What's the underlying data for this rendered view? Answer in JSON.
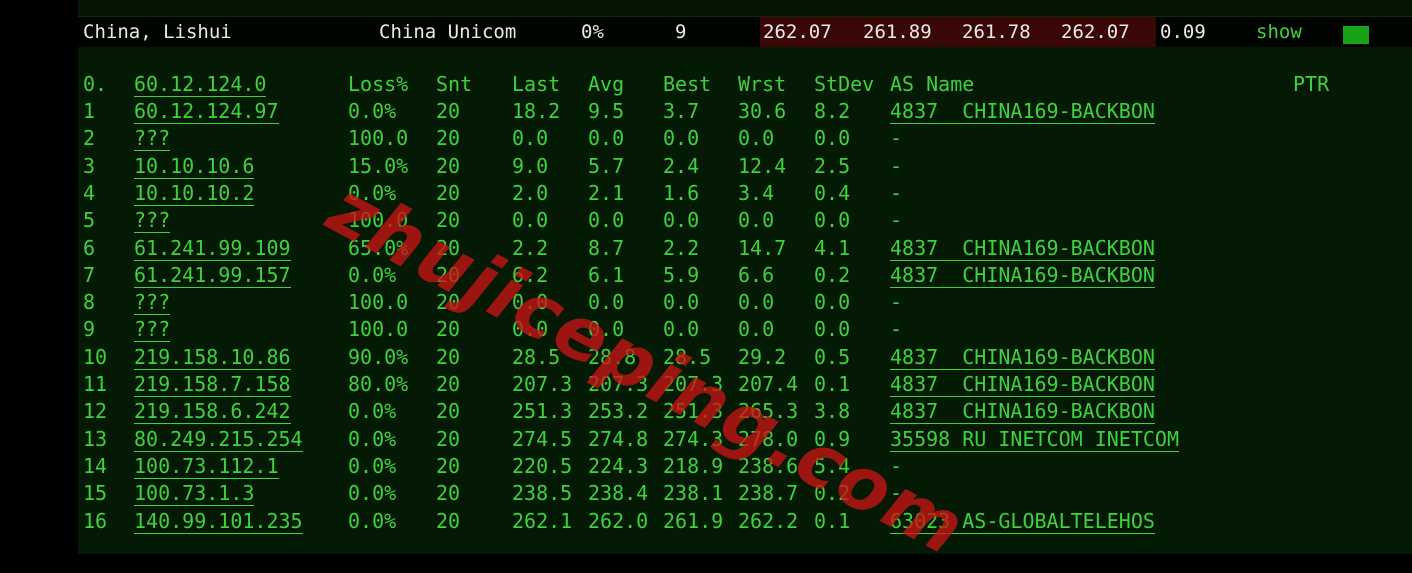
{
  "summary": {
    "location": "China, Lishui",
    "isp": "China Unicom",
    "loss": "0%",
    "count": "9",
    "last": "262.07",
    "avg": "261.89",
    "best": "261.78",
    "wrst": "262.07",
    "stdev": "0.09",
    "show_label": "show",
    "colors": {
      "red_band": "#3a0707",
      "green_marker": "#16a316"
    }
  },
  "headers": {
    "hop": "0.",
    "target": "60.12.124.0",
    "loss": "Loss%",
    "snt": "Snt",
    "last": "Last",
    "avg": "Avg",
    "best": "Best",
    "wrst": "Wrst",
    "stdev": "StDev",
    "as_name": "AS Name",
    "ptr": "PTR"
  },
  "hops": [
    {
      "hop": "1",
      "ip": "60.12.124.97",
      "loss": "0.0%",
      "snt": "20",
      "last": "18.2",
      "avg": "9.5",
      "best": "3.7",
      "wrst": "30.6",
      "stdev": "8.2",
      "as": "4837  CHINA169-BACKBON"
    },
    {
      "hop": "2",
      "ip": "???",
      "loss": "100.0",
      "snt": "20",
      "last": "0.0",
      "avg": "0.0",
      "best": "0.0",
      "wrst": "0.0",
      "stdev": "0.0",
      "as": "-"
    },
    {
      "hop": "3",
      "ip": "10.10.10.6",
      "loss": "15.0%",
      "snt": "20",
      "last": "9.0",
      "avg": "5.7",
      "best": "2.4",
      "wrst": "12.4",
      "stdev": "2.5",
      "as": "-"
    },
    {
      "hop": "4",
      "ip": "10.10.10.2",
      "loss": "0.0%",
      "snt": "20",
      "last": "2.0",
      "avg": "2.1",
      "best": "1.6",
      "wrst": "3.4",
      "stdev": "0.4",
      "as": "-"
    },
    {
      "hop": "5",
      "ip": "???",
      "loss": "100.0",
      "snt": "20",
      "last": "0.0",
      "avg": "0.0",
      "best": "0.0",
      "wrst": "0.0",
      "stdev": "0.0",
      "as": "-"
    },
    {
      "hop": "6",
      "ip": "61.241.99.109",
      "loss": "65.0%",
      "snt": "20",
      "last": "2.2",
      "avg": "8.7",
      "best": "2.2",
      "wrst": "14.7",
      "stdev": "4.1",
      "as": "4837  CHINA169-BACKBON"
    },
    {
      "hop": "7",
      "ip": "61.241.99.157",
      "loss": "0.0%",
      "snt": "20",
      "last": "6.2",
      "avg": "6.1",
      "best": "5.9",
      "wrst": "6.6",
      "stdev": "0.2",
      "as": "4837  CHINA169-BACKBON"
    },
    {
      "hop": "8",
      "ip": "???",
      "loss": "100.0",
      "snt": "20",
      "last": "0.0",
      "avg": "0.0",
      "best": "0.0",
      "wrst": "0.0",
      "stdev": "0.0",
      "as": "-"
    },
    {
      "hop": "9",
      "ip": "???",
      "loss": "100.0",
      "snt": "20",
      "last": "0.0",
      "avg": "0.0",
      "best": "0.0",
      "wrst": "0.0",
      "stdev": "0.0",
      "as": "-"
    },
    {
      "hop": "10",
      "ip": "219.158.10.86",
      "loss": "90.0%",
      "snt": "20",
      "last": "28.5",
      "avg": "28.8",
      "best": "28.5",
      "wrst": "29.2",
      "stdev": "0.5",
      "as": "4837  CHINA169-BACKBON"
    },
    {
      "hop": "11",
      "ip": "219.158.7.158",
      "loss": "80.0%",
      "snt": "20",
      "last": "207.3",
      "avg": "207.3",
      "best": "207.3",
      "wrst": "207.4",
      "stdev": "0.1",
      "as": "4837  CHINA169-BACKBON"
    },
    {
      "hop": "12",
      "ip": "219.158.6.242",
      "loss": "0.0%",
      "snt": "20",
      "last": "251.3",
      "avg": "253.2",
      "best": "251.3",
      "wrst": "265.3",
      "stdev": "3.8",
      "as": "4837  CHINA169-BACKBON"
    },
    {
      "hop": "13",
      "ip": "80.249.215.254",
      "loss": "0.0%",
      "snt": "20",
      "last": "274.5",
      "avg": "274.8",
      "best": "274.3",
      "wrst": "278.0",
      "stdev": "0.9",
      "as": "35598 RU INETCOM INETCOM"
    },
    {
      "hop": "14",
      "ip": "100.73.112.1",
      "loss": "0.0%",
      "snt": "20",
      "last": "220.5",
      "avg": "224.3",
      "best": "218.9",
      "wrst": "238.6",
      "stdev": "5.4",
      "as": "-"
    },
    {
      "hop": "15",
      "ip": "100.73.1.3",
      "loss": "0.0%",
      "snt": "20",
      "last": "238.5",
      "avg": "238.4",
      "best": "238.1",
      "wrst": "238.7",
      "stdev": "0.2",
      "as": "-"
    },
    {
      "hop": "16",
      "ip": "140.99.101.235",
      "loss": "0.0%",
      "snt": "20",
      "last": "262.1",
      "avg": "262.0",
      "best": "261.9",
      "wrst": "262.2",
      "stdev": "0.1",
      "as": "63023 AS-GLOBALTELEHOS"
    }
  ],
  "watermark": "zhujiceping.com",
  "colors": {
    "panel_bg": "#041a04",
    "text_green": "#3fd13f",
    "watermark_red": "#c81414"
  }
}
